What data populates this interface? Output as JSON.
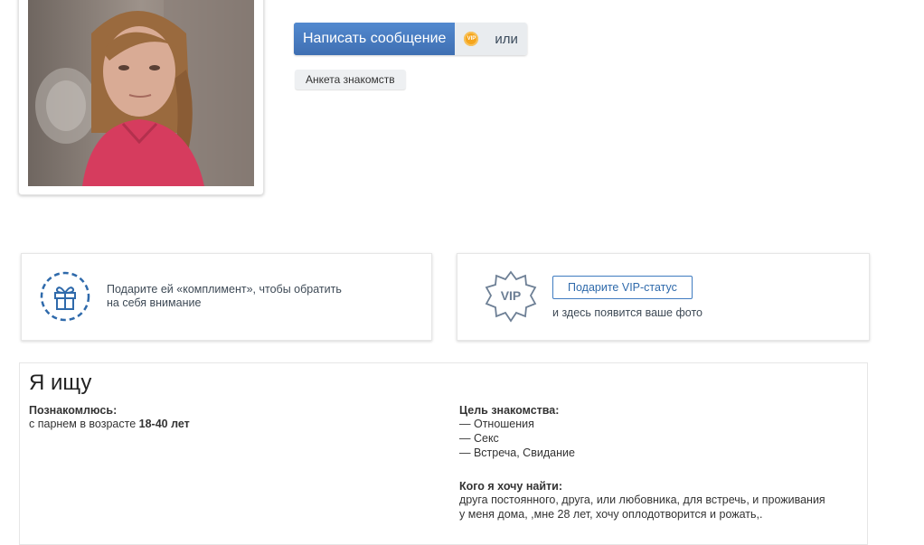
{
  "profile": {
    "photo_alt": "фото профиля",
    "write_message_label": "Написать сообщение",
    "vip_badge_text": "VIP",
    "or_label": "или",
    "dating_profile_label": "Анкета знакомств"
  },
  "promos": {
    "compliment_line1": "Подарите ей «комплимент», чтобы обратить",
    "compliment_line2": "на себя внимание",
    "vip_icon_text": "VIP",
    "vip_button_label": "Подарите VIP-статус",
    "vip_subtext": "и здесь появится ваше фото"
  },
  "looking_for": {
    "title": "Я ищу",
    "meet_label": "Познакомлюсь:",
    "meet_prefix": "с парнем в возрасте",
    "meet_age": "18-40 лет",
    "goal_label": "Цель знакомства:",
    "goals": [
      "— Отношения",
      "— Секс",
      "— Встреча, Свидание"
    ],
    "who_label": "Кого я хочу найти:",
    "who_line1": "друга постоянного, друга, или любовника, для встречь, и проживания",
    "who_line2": "у меня дома, ,мне 28 лет, хочу оплодотворится и рожать,."
  },
  "colors": {
    "primary_button": "#4679bd",
    "accent_blue": "#2f6aab",
    "vip_orange": "#f5a51d"
  }
}
